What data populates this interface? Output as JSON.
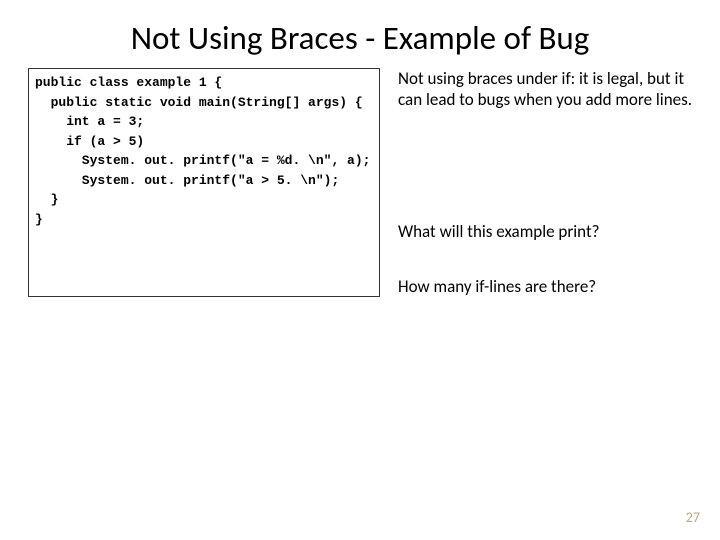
{
  "title": "Not Using Braces - Example of Bug",
  "code": "public class example 1 {\n  public static void main(String[] args) {\n    int a = 3;\n    if (a > 5)\n      System. out. printf(\"a = %d. \\n\", a);\n      System. out. printf(\"a > 5. \\n\");\n  }\n}",
  "notes": {
    "n1": "Not using braces under if: it is legal, but it can lead to bugs when you add more lines.",
    "n2": "What will this example print?",
    "n3": "How many if-lines are there?"
  },
  "page_number": "27"
}
